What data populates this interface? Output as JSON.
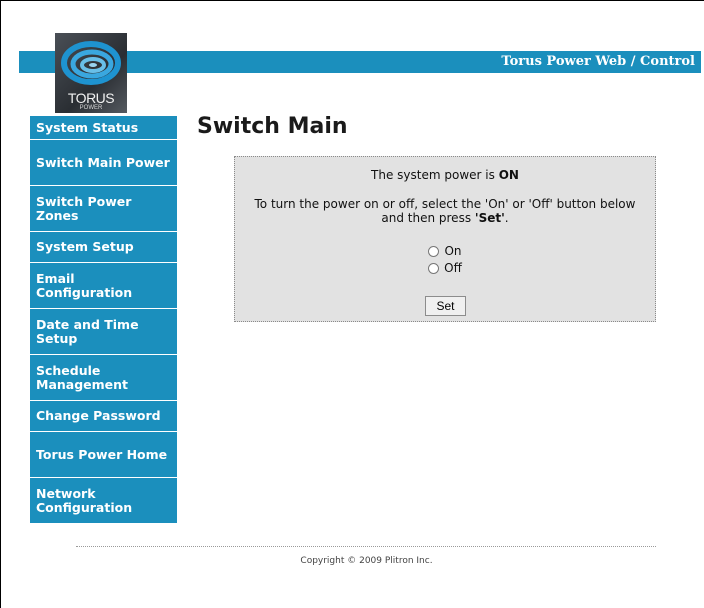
{
  "header": {
    "title": "Torus Power Web / Control"
  },
  "logo": {
    "text": "TORUS",
    "subtext": "POWER"
  },
  "sidebar": {
    "items": [
      {
        "label": "System Status"
      },
      {
        "label": "Switch Main Power"
      },
      {
        "label": "Switch Power Zones"
      },
      {
        "label": "System Setup"
      },
      {
        "label": "Email Configuration"
      },
      {
        "label": "Date and Time Setup"
      },
      {
        "label": "Schedule Management"
      },
      {
        "label": "Change Password"
      },
      {
        "label": "Torus Power Home"
      },
      {
        "label": "Network Configuration"
      }
    ]
  },
  "main": {
    "title": "Switch Main",
    "status_prefix": "The system power is ",
    "status_value": "ON",
    "instruction_prefix": "To turn the power on or off, select the 'On' or 'Off' button below and then press ",
    "instruction_emphasis": "'Set'",
    "instruction_suffix": ".",
    "options": [
      {
        "label": "On",
        "selected": false
      },
      {
        "label": "Off",
        "selected": false
      }
    ],
    "set_label": "Set"
  },
  "footer": {
    "copyright": "Copyright © 2009 Plitron Inc."
  },
  "colors": {
    "accent": "#1b8fbd",
    "panel_bg": "#e2e2e2"
  }
}
